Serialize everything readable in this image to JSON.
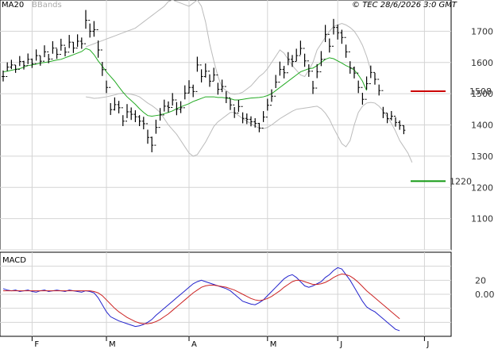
{
  "header": {
    "legend_ma": "MA20",
    "legend_bb": "BBands",
    "copyright": "© TEC 28/6/2026 3:0 GMT"
  },
  "macd_label": "MACD",
  "colors": {
    "ma": "#22aa22",
    "bb": "#bbbbbb",
    "price": "#000000",
    "macd": "#2222cc",
    "signal": "#cc2222",
    "resistance": "#cc0000",
    "support": "#119911",
    "grid": "#d4d4d4"
  },
  "chart_data": [
    {
      "type": "ohlc",
      "panel": "price",
      "yticks": [
        1100,
        1200,
        1300,
        1400,
        1500,
        1600,
        1700
      ],
      "ylim": [
        1000,
        1800
      ],
      "months": [
        "F",
        "M",
        "A",
        "M",
        "J",
        "J"
      ],
      "close": [
        1555,
        1585,
        1592,
        1578,
        1603,
        1590,
        1610,
        1596,
        1622,
        1604,
        1634,
        1611,
        1646,
        1626,
        1655,
        1633,
        1665,
        1646,
        1668,
        1660,
        1735,
        1700,
        1705,
        1640,
        1577,
        1520,
        1449,
        1465,
        1455,
        1412,
        1442,
        1434,
        1426,
        1412,
        1404,
        1360,
        1335,
        1392,
        1432,
        1460,
        1456,
        1480,
        1450,
        1455,
        1502,
        1520,
        1507,
        1592,
        1555,
        1572,
        1540,
        1560,
        1514,
        1523,
        1487,
        1464,
        1438,
        1459,
        1421,
        1418,
        1410,
        1405,
        1390,
        1425,
        1463,
        1492,
        1537,
        1578,
        1567,
        1610,
        1603,
        1622,
        1645,
        1605,
        1572,
        1518,
        1570,
        1610,
        1690,
        1652,
        1712,
        1695,
        1680,
        1634,
        1582,
        1566,
        1520,
        1482,
        1532,
        1568,
        1546,
        1510,
        1438,
        1420,
        1428,
        1408,
        1398,
        1383
      ],
      "range": [
        35,
        28,
        30,
        25,
        32,
        28,
        34,
        30,
        36,
        32,
        38,
        30,
        40,
        32,
        38,
        30,
        42,
        35,
        40,
        36,
        60,
        45,
        50,
        55,
        45,
        40,
        38,
        42,
        40,
        35,
        45,
        40,
        38,
        35,
        40,
        45,
        50,
        45,
        40,
        38,
        35,
        40,
        42,
        38,
        45,
        42,
        40,
        48,
        42,
        45,
        40,
        42,
        38,
        40,
        38,
        36,
        35,
        38,
        35,
        34,
        32,
        30,
        30,
        35,
        38,
        40,
        42,
        45,
        40,
        42,
        38,
        40,
        45,
        42,
        40,
        42,
        45,
        48,
        55,
        45,
        50,
        48,
        45,
        42,
        40,
        38,
        40,
        38,
        42,
        40,
        38,
        35,
        36,
        32,
        30,
        30,
        30,
        28
      ],
      "ma20": [
        1570,
        1572,
        1575,
        1578,
        1580,
        1585,
        1590,
        1592,
        1595,
        1598,
        1600,
        1602,
        1605,
        1608,
        1610,
        1615,
        1620,
        1625,
        1630,
        1635,
        1645,
        1640,
        1625,
        1605,
        1588,
        1570,
        1555,
        1540,
        1522,
        1505,
        1490,
        1478,
        1466,
        1452,
        1440,
        1430,
        1428,
        1430,
        1432,
        1436,
        1440,
        1445,
        1452,
        1458,
        1463,
        1468,
        1475,
        1480,
        1485,
        1490,
        1490,
        1490,
        1488,
        1488,
        1486,
        1484,
        1480,
        1480,
        1482,
        1484,
        1486,
        1487,
        1488,
        1490,
        1494,
        1500,
        1510,
        1520,
        1530,
        1540,
        1550,
        1560,
        1570,
        1575,
        1580,
        1582,
        1590,
        1600,
        1610,
        1615,
        1612,
        1605,
        1598,
        1590,
        1584,
        1576,
        1560,
        1540,
        1510
      ],
      "bb_upper": [
        1650,
        1655,
        1660,
        1665,
        1670,
        1675,
        1680,
        1685,
        1690,
        1695,
        1700,
        1705,
        1710,
        1720,
        1730,
        1740,
        1750,
        1760,
        1770,
        1780,
        1795,
        1800,
        1795,
        1790,
        1785,
        1780,
        1790,
        1800,
        1780,
        1730,
        1660,
        1605,
        1555,
        1520,
        1510,
        1500,
        1498,
        1500,
        1505,
        1515,
        1525,
        1540,
        1555,
        1565,
        1580,
        1600,
        1620,
        1640,
        1630,
        1610,
        1590,
        1575,
        1560,
        1555,
        1575,
        1600,
        1640,
        1660,
        1680,
        1700,
        1715,
        1720,
        1725,
        1720,
        1712,
        1700,
        1680,
        1655,
        1620,
        1575
      ],
      "bb_lower": [
        1490,
        1488,
        1485,
        1486,
        1488,
        1490,
        1493,
        1496,
        1500,
        1502,
        1500,
        1498,
        1495,
        1490,
        1480,
        1470,
        1462,
        1452,
        1440,
        1420,
        1400,
        1385,
        1370,
        1350,
        1330,
        1310,
        1300,
        1305,
        1325,
        1345,
        1370,
        1395,
        1410,
        1420,
        1430,
        1440,
        1440,
        1430,
        1420,
        1412,
        1404,
        1396,
        1390,
        1388,
        1392,
        1400,
        1410,
        1420,
        1428,
        1436,
        1444,
        1450,
        1452,
        1454,
        1456,
        1458,
        1460,
        1452,
        1438,
        1418,
        1390,
        1365,
        1340,
        1330,
        1350,
        1400,
        1440,
        1460,
        1470,
        1472,
        1470,
        1460,
        1445,
        1425,
        1405,
        1380,
        1350,
        1330,
        1310,
        1280
      ],
      "ma_end_offset": 0,
      "resistance": 1508,
      "support": 1220
    },
    {
      "type": "line",
      "panel": "macd",
      "yticks": [
        0,
        20
      ],
      "ylim": [
        -60,
        60
      ],
      "series": [
        {
          "role": "macd",
          "values": [
            8,
            6,
            5,
            6,
            4,
            5,
            6,
            4,
            3,
            5,
            6,
            4,
            5,
            6,
            5,
            4,
            6,
            5,
            4,
            3,
            5,
            4,
            2,
            -5,
            -15,
            -25,
            -32,
            -35,
            -38,
            -40,
            -42,
            -44,
            -46,
            -45,
            -43,
            -40,
            -36,
            -30,
            -25,
            -20,
            -15,
            -10,
            -5,
            0,
            5,
            10,
            15,
            18,
            20,
            18,
            16,
            14,
            12,
            10,
            8,
            5,
            0,
            -5,
            -10,
            -12,
            -14,
            -15,
            -12,
            -8,
            -2,
            4,
            10,
            16,
            22,
            26,
            28,
            24,
            18,
            12,
            10,
            12,
            15,
            18,
            24,
            28,
            34,
            38,
            36,
            28,
            20,
            10,
            0,
            -10,
            -18,
            -22,
            -25,
            -30,
            -35,
            -40,
            -45,
            -50,
            -52
          ]
        },
        {
          "role": "signal",
          "values": [
            5,
            5,
            5,
            5,
            5,
            5,
            5,
            5,
            5,
            5,
            5,
            5,
            5,
            5,
            5,
            5,
            5,
            5,
            5,
            5,
            5,
            5,
            4,
            2,
            -2,
            -8,
            -14,
            -20,
            -25,
            -29,
            -33,
            -36,
            -39,
            -41,
            -42,
            -42,
            -41,
            -39,
            -36,
            -32,
            -28,
            -23,
            -18,
            -13,
            -8,
            -3,
            2,
            6,
            10,
            12,
            13,
            13,
            12,
            11,
            10,
            8,
            6,
            3,
            0,
            -3,
            -6,
            -8,
            -9,
            -8,
            -6,
            -3,
            1,
            5,
            10,
            14,
            18,
            20,
            20,
            18,
            16,
            14,
            14,
            15,
            17,
            20,
            24,
            27,
            29,
            28,
            26,
            22,
            17,
            11,
            5,
            0,
            -5,
            -10,
            -15,
            -20,
            -25,
            -30,
            -35
          ]
        }
      ]
    }
  ]
}
